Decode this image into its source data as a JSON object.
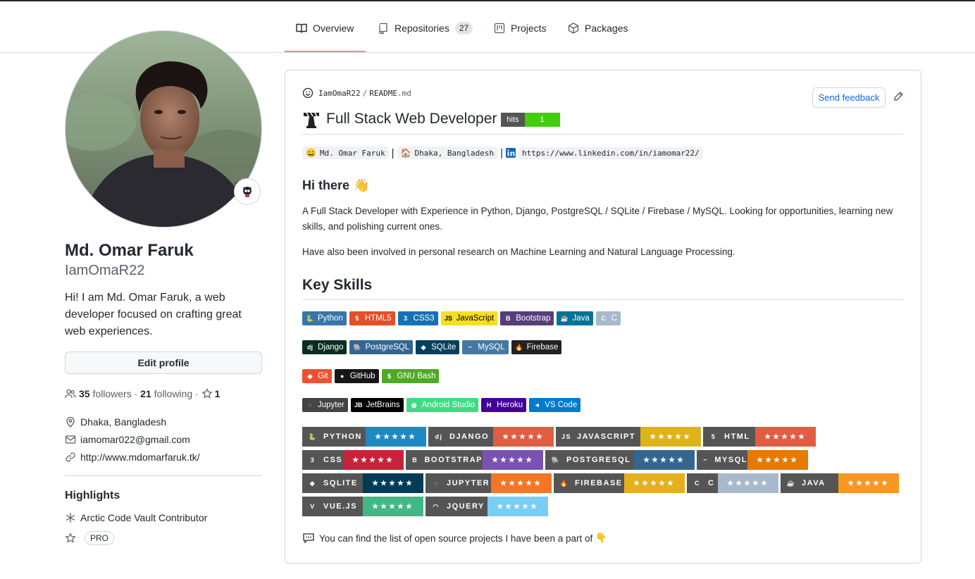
{
  "tabs": [
    {
      "label": "Overview",
      "icon": "book-icon"
    },
    {
      "label": "Repositories",
      "icon": "repo-icon",
      "count": "27"
    },
    {
      "label": "Projects",
      "icon": "project-icon"
    },
    {
      "label": "Packages",
      "icon": "package-icon"
    }
  ],
  "profile": {
    "name": "Md. Omar Faruk",
    "login": "IamOmaR22",
    "bio": "Hi! I am Md. Omar Faruk, a web developer focused on crafting great web experiences.",
    "edit_label": "Edit profile",
    "followers": "35",
    "followers_label": "followers",
    "dot": " · ",
    "following": "21",
    "following_label": "following",
    "stars": "1",
    "location": "Dhaka, Bangladesh",
    "email": "iamomar022@gmail.com",
    "website": "http://www.mdomarfaruk.tk/"
  },
  "highlights": {
    "title": "Highlights",
    "item": "Arctic Code Vault Contributor",
    "pro": "PRO"
  },
  "readme": {
    "owner": "IamOmaR22",
    "sep": "/",
    "file": "README",
    "ext": ".md",
    "feedback": "Send feedback",
    "title": "Full Stack Web Developer",
    "hits_label": "hits",
    "hits_value": "1",
    "info_name": "Md. Omar Faruk",
    "info_location": "Dhaka, Bangladesh",
    "info_linkedin": "https://www.linkedin.com/in/iamomar22/",
    "pipe": "|",
    "greeting": "Hi there",
    "para1": "A Full Stack Developer with Experience in Python, Django, PostgreSQL / SQLite / Firebase / MySQL. Looking for opportunities, learning new skills, and polishing current ones.",
    "para2": "Have also been involved in personal research on Machine Learning and Natural Language Processing.",
    "skills_title": "Key Skills",
    "footer": "You can find the list of open source projects I have been a part of"
  },
  "badge_rows": [
    [
      {
        "label": "Python",
        "bg": "#3776ab",
        "icon": "python-icon",
        "glyph": "🐍"
      },
      {
        "label": "HTML5",
        "bg": "#e34f26",
        "icon": "html5-icon",
        "glyph": "5"
      },
      {
        "label": "CSS3",
        "bg": "#1572b6",
        "icon": "css3-icon",
        "glyph": "3"
      },
      {
        "label": "JavaScript",
        "bg": "#f7df1e",
        "icon": "javascript-icon",
        "glyph": "JS",
        "fg": "#000"
      },
      {
        "label": "Bootstrap",
        "bg": "#563d7c",
        "icon": "bootstrap-icon",
        "glyph": "B"
      },
      {
        "label": "Java",
        "bg": "#007396",
        "icon": "java-icon",
        "glyph": "☕"
      },
      {
        "label": "C",
        "bg": "#a8b9cc",
        "icon": "c-icon",
        "glyph": "C"
      }
    ],
    [
      {
        "label": "Django",
        "bg": "#092e20",
        "icon": "django-icon",
        "glyph": "dj"
      },
      {
        "label": "PostgreSQL",
        "bg": "#336791",
        "icon": "postgresql-icon",
        "glyph": "🐘"
      },
      {
        "label": "SQLite",
        "bg": "#07405e",
        "icon": "sqlite-icon",
        "glyph": "◆"
      },
      {
        "label": "MySQL",
        "bg": "#4479a1",
        "icon": "mysql-icon",
        "glyph": "~"
      },
      {
        "label": "Firebase",
        "bg": "#222222",
        "icon": "firebase-icon",
        "glyph": "🔥"
      }
    ],
    [
      {
        "label": "Git",
        "bg": "#f05032",
        "icon": "git-icon",
        "glyph": "◆"
      },
      {
        "label": "GitHub",
        "bg": "#181717",
        "icon": "github-icon",
        "glyph": "●"
      },
      {
        "label": "GNU Bash",
        "bg": "#4eaa25",
        "icon": "bash-icon",
        "glyph": "$"
      }
    ],
    [
      {
        "label": "Jupyter",
        "bg": "#444444",
        "icon": "jupyter-icon",
        "glyph": "◌"
      },
      {
        "label": "JetBrains",
        "bg": "#000000",
        "icon": "jetbrains-icon",
        "glyph": "JB"
      },
      {
        "label": "Android Studio",
        "bg": "#3ddc84",
        "icon": "android-studio-icon",
        "glyph": "◉"
      },
      {
        "label": "Heroku",
        "bg": "#430098",
        "icon": "heroku-icon",
        "glyph": "H"
      },
      {
        "label": "VS Code",
        "bg": "#007acc",
        "icon": "vscode-icon",
        "glyph": "◄"
      }
    ]
  ],
  "skill_badges": [
    {
      "label": "PYTHON",
      "icon": "python-icon",
      "glyph": "🐍",
      "color": "#1e88c4",
      "stars": "★★★★★"
    },
    {
      "label": "DJANGO",
      "icon": "django-icon",
      "glyph": "dj",
      "color": "#e05d44",
      "stars": "★★★★★"
    },
    {
      "label": "JAVASCRIPT",
      "icon": "javascript-icon",
      "glyph": "JS",
      "color": "#dfb317",
      "stars": "★★★★★"
    },
    {
      "label": "HTML",
      "icon": "html5-icon",
      "glyph": "5",
      "color": "#e05d44",
      "stars": "★★★★★"
    },
    {
      "label": "CSS",
      "icon": "css3-icon",
      "glyph": "3",
      "color": "#c8213a",
      "stars": "★★★★★"
    },
    {
      "label": "BOOTSTRAP",
      "icon": "bootstrap-icon",
      "glyph": "B",
      "color": "#7952b3",
      "stars": "★★★★★"
    },
    {
      "label": "POSTGRESQL",
      "icon": "postgresql-icon",
      "glyph": "🐘",
      "color": "#336791",
      "stars": "★★★★★"
    },
    {
      "label": "MYSQL",
      "icon": "mysql-icon",
      "glyph": "~",
      "color": "#e57a00",
      "stars": "★★★★★"
    },
    {
      "label": "SQLITE",
      "icon": "sqlite-icon",
      "glyph": "◆",
      "color": "#003b57",
      "stars": "★★★★★"
    },
    {
      "label": "JUPYTER",
      "icon": "jupyter-icon",
      "glyph": "◌",
      "color": "#f37626",
      "stars": "★★★★★"
    },
    {
      "label": "FIREBASE",
      "icon": "firebase-icon",
      "glyph": "🔥",
      "color": "#e3b11b",
      "stars": "★★★★★"
    },
    {
      "label": "C",
      "icon": "c-icon",
      "glyph": "C",
      "color": "#a8b9cc",
      "stars": "★★★★★"
    },
    {
      "label": "JAVA",
      "icon": "java-icon",
      "glyph": "☕",
      "color": "#f89820",
      "stars": "★★★★★"
    },
    {
      "label": "VUE.JS",
      "icon": "vue-icon",
      "glyph": "V",
      "color": "#41b883",
      "stars": "★★★★★"
    },
    {
      "label": "JQUERY",
      "icon": "jquery-icon",
      "glyph": "◠",
      "color": "#78cff5",
      "stars": "★★★★★"
    }
  ]
}
